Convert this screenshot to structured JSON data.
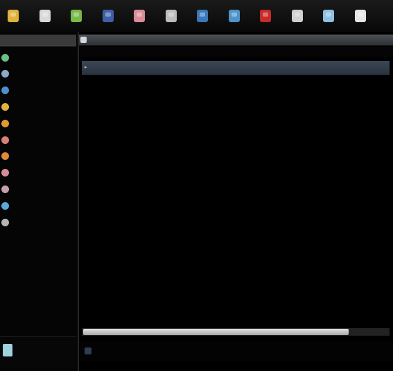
{
  "toolbar": {
    "buttons": [
      {
        "icon": "folder-icon",
        "color": "#e0b23a"
      },
      {
        "icon": "document-icon",
        "color": "#d9d9d9"
      },
      {
        "icon": "leaf-icon",
        "color": "#79b94a"
      },
      {
        "icon": "monitor-icon",
        "color": "#3f5fa8"
      },
      {
        "icon": "image-icon",
        "color": "#d98d95"
      },
      {
        "icon": "page-icon",
        "color": "#bdbdbd"
      },
      {
        "icon": "globe-icon",
        "color": "#3a78b8"
      },
      {
        "icon": "drive-icon",
        "color": "#4f94c9"
      },
      {
        "icon": "stop-icon",
        "color": "#c92a2a"
      },
      {
        "icon": "clipboard-icon",
        "color": "#d0d0d0"
      },
      {
        "icon": "arrow-icon",
        "color": "#8fc0e0"
      },
      {
        "icon": "sheet-icon",
        "color": "#e6e6e6"
      }
    ]
  },
  "sidebar": {
    "items": [
      {
        "icon": "home-icon",
        "color": "#6cbf85"
      },
      {
        "icon": "desktop-icon",
        "color": "#8fa7c9"
      },
      {
        "icon": "network-icon",
        "color": "#4d8fd1"
      },
      {
        "icon": "folder-icon",
        "color": "#e3b13c"
      },
      {
        "icon": "folder-icon",
        "color": "#e09a2e"
      },
      {
        "icon": "music-icon",
        "color": "#d8807a"
      },
      {
        "icon": "picture-icon",
        "color": "#e08b3a"
      },
      {
        "icon": "video-icon",
        "color": "#d98b9b"
      },
      {
        "icon": "download-icon",
        "color": "#c6a0a8"
      },
      {
        "icon": "trash-icon",
        "color": "#59a9d9"
      },
      {
        "icon": "drive-icon",
        "color": "#b5b5b5"
      }
    ]
  },
  "footer": {
    "icon": "device-icon"
  },
  "main": {
    "columns": [
      {
        "icon": "sort-arrow-icon"
      },
      {
        "icon": "column-divider"
      },
      {
        "icon": "column-divider"
      }
    ],
    "scroll_fraction": 0.87
  }
}
